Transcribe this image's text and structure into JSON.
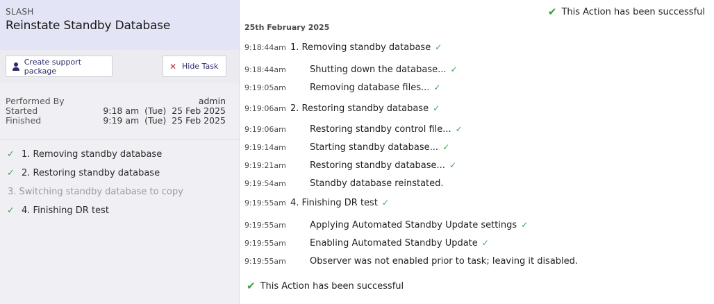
{
  "header": {
    "app_name": "SLASH",
    "task_title": "Reinstate Standby Database"
  },
  "toolbar": {
    "support_label": "Create support package",
    "hide_label": "Hide Task"
  },
  "meta": {
    "performed_by_label": "Performed By",
    "performed_by_value": "admin",
    "started_label": "Started",
    "started_value": "9:18 am  (Tue)  25 Feb 2025",
    "finished_label": "Finished",
    "finished_value": "9:19 am  (Tue)  25 Feb 2025"
  },
  "steps": [
    {
      "label": "1. Removing standby database",
      "status": "done"
    },
    {
      "label": "2. Restoring standby database",
      "status": "done"
    },
    {
      "label": "3. Switching standby database to copy",
      "status": "skipped"
    },
    {
      "label": "4. Finishing DR test",
      "status": "done"
    }
  ],
  "check_glyph": "✓",
  "success_message": "This Action has been successful",
  "log": {
    "date": "25th February 2025",
    "entries": [
      {
        "time": "9:18:44am",
        "text": "1. Removing standby database",
        "level": "main",
        "tick": true
      },
      {
        "time": "9:18:44am",
        "text": "Shutting down the database...",
        "level": "sub",
        "tick": true
      },
      {
        "time": "9:19:05am",
        "text": "Removing database files...",
        "level": "sub",
        "tick": true
      },
      {
        "time": "9:19:06am",
        "text": "2. Restoring standby database",
        "level": "main",
        "tick": true
      },
      {
        "time": "9:19:06am",
        "text": "Restoring standby control file...",
        "level": "sub",
        "tick": true
      },
      {
        "time": "9:19:14am",
        "text": "Starting standby database...",
        "level": "sub",
        "tick": true
      },
      {
        "time": "9:19:21am",
        "text": "Restoring standby database...",
        "level": "sub",
        "tick": true
      },
      {
        "time": "9:19:54am",
        "text": "Standby database reinstated.",
        "level": "sub",
        "tick": false
      },
      {
        "time": "9:19:55am",
        "text": "4. Finishing DR test",
        "level": "main",
        "tick": true
      },
      {
        "time": "9:19:55am",
        "text": "Applying Automated Standby Update settings",
        "level": "sub",
        "tick": true
      },
      {
        "time": "9:19:55am",
        "text": "Enabling Automated Standby Update",
        "level": "sub",
        "tick": true
      },
      {
        "time": "9:19:55am",
        "text": "Observer was not enabled prior to task; leaving it disabled.",
        "level": "sub",
        "tick": false
      }
    ]
  },
  "colors": {
    "accent": "#2a2a6a",
    "success": "#3fa34d",
    "danger": "#c0282f",
    "header_bg": "#e3e4f5",
    "panel_bg": "#f0eff4"
  },
  "icons": {
    "support": "user-icon",
    "hide": "close-icon",
    "success": "checkmark-icon"
  }
}
